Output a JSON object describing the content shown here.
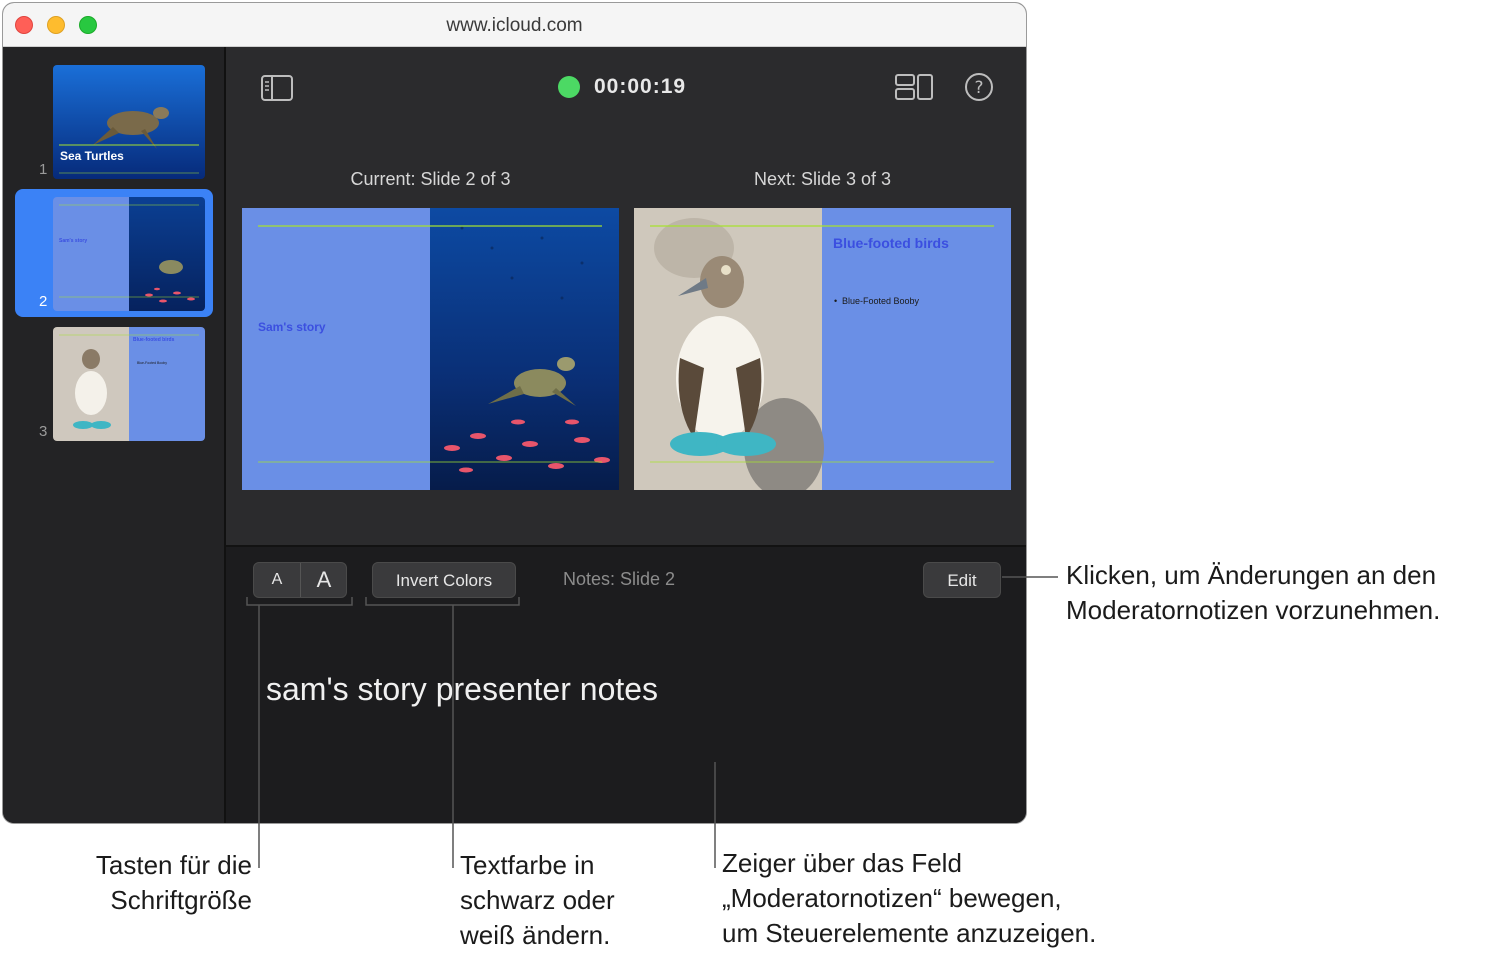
{
  "window": {
    "url": "www.icloud.com"
  },
  "sidebar": {
    "slides": [
      {
        "number": "1",
        "title": "Sea Turtles"
      },
      {
        "number": "2",
        "title": "Sam's story",
        "selected": true
      },
      {
        "number": "3",
        "title": "Blue-footed birds",
        "bullet": "Blue-Footed Booby"
      }
    ]
  },
  "toolbar": {
    "timer": "00:00:19",
    "status_color": "#4cd964",
    "sidebar_icon": "sidebar-toggle-icon",
    "layout_icon": "layout-icon",
    "help_icon": "help-icon"
  },
  "current": {
    "label": "Current: Slide 2 of 3",
    "title": "Sam's story"
  },
  "next": {
    "label": "Next: Slide 3 of 3",
    "title": "Blue-footed birds",
    "bullet": "Blue-Footed Booby"
  },
  "notes": {
    "font_small": "A",
    "font_large": "A",
    "invert_colors": "Invert Colors",
    "label": "Notes: Slide 2",
    "edit": "Edit",
    "text": "sam's story presenter notes"
  },
  "callouts": {
    "edit": "Klicken, um Änderungen an den Moderatornotizen vorzunehmen.",
    "font_size_line1": "Tasten für die",
    "font_size_line2": "Schriftgröße",
    "invert_line1": "Textfarbe in",
    "invert_line2": "schwarz oder",
    "invert_line3": "weiß ändern.",
    "hover_line1": "Zeiger über das Feld",
    "hover_line2": "„Moderatornotizen“ bewegen,",
    "hover_line3": "um Steuerelemente anzuzeigen.",
    "edit_line1": "Klicken, um Änderungen an den",
    "edit_line2": "Moderatornotizen vorzunehmen."
  },
  "colors": {
    "accent": "#3b82f6",
    "slide_bg": "#6a8fe6",
    "slide_title": "#3b4fe0"
  }
}
